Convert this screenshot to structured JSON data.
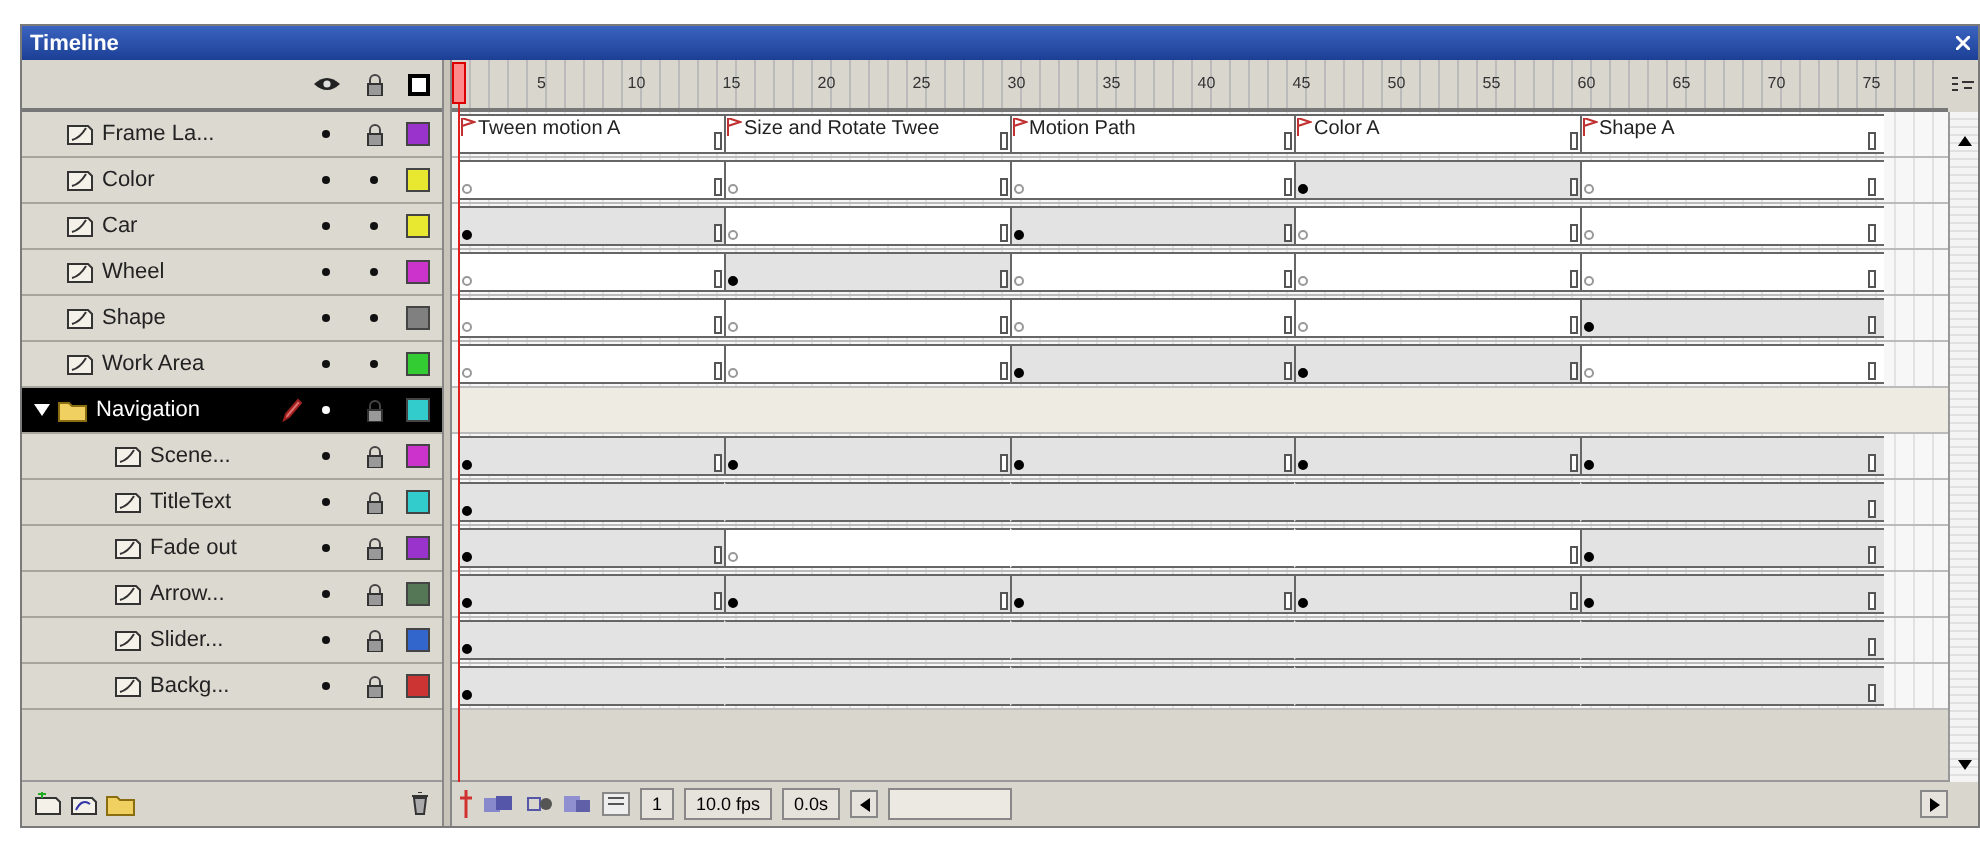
{
  "window": {
    "title": "Timeline"
  },
  "ruler": {
    "ticks": [
      "5",
      "10",
      "15",
      "20",
      "25",
      "30",
      "35",
      "40",
      "45",
      "50",
      "55",
      "60",
      "65",
      "70",
      "75"
    ]
  },
  "layers": [
    {
      "kind": "labels",
      "name": "Frame La...",
      "selected": false,
      "locked": true,
      "color": "#9933cc",
      "frames": [
        {
          "label": "Tween motion A"
        },
        {
          "label": "Size and Rotate Twee"
        },
        {
          "label": "Motion Path"
        },
        {
          "label": "Color A"
        },
        {
          "label": "Shape A"
        }
      ]
    },
    {
      "kind": "layer",
      "name": "Color",
      "selected": false,
      "locked": false,
      "color": "#e8e830",
      "frames": [
        {
          "keyframe": true,
          "content": false
        },
        {
          "keyframe": true,
          "content": false
        },
        {
          "keyframe": true,
          "content": false
        },
        {
          "keyframe": true,
          "content": true
        },
        {
          "keyframe": true,
          "content": false
        }
      ]
    },
    {
      "kind": "layer",
      "name": "Car",
      "selected": false,
      "locked": false,
      "color": "#e8e830",
      "frames": [
        {
          "keyframe": true,
          "content": true
        },
        {
          "keyframe": true,
          "content": false
        },
        {
          "keyframe": true,
          "content": true
        },
        {
          "keyframe": true,
          "content": false
        },
        {
          "keyframe": true,
          "content": false
        }
      ]
    },
    {
      "kind": "layer",
      "name": "Wheel",
      "selected": false,
      "locked": false,
      "color": "#cc33cc",
      "frames": [
        {
          "keyframe": true,
          "content": false
        },
        {
          "keyframe": true,
          "content": true
        },
        {
          "keyframe": true,
          "content": false
        },
        {
          "keyframe": true,
          "content": false
        },
        {
          "keyframe": true,
          "content": false
        }
      ]
    },
    {
      "kind": "layer",
      "name": "Shape",
      "selected": false,
      "locked": false,
      "color": "#808080",
      "frames": [
        {
          "keyframe": true,
          "content": false
        },
        {
          "keyframe": true,
          "content": false
        },
        {
          "keyframe": true,
          "content": false
        },
        {
          "keyframe": true,
          "content": false
        },
        {
          "keyframe": true,
          "content": true
        }
      ]
    },
    {
      "kind": "layer",
      "name": "Work Area",
      "selected": false,
      "locked": false,
      "color": "#33cc33",
      "frames": [
        {
          "keyframe": true,
          "content": false
        },
        {
          "keyframe": true,
          "content": false
        },
        {
          "keyframe": true,
          "content": true
        },
        {
          "keyframe": true,
          "content": true
        },
        {
          "keyframe": true,
          "content": false
        }
      ]
    },
    {
      "kind": "folder",
      "name": "Navigation",
      "selected": true,
      "expanded": true,
      "locked": true,
      "color": "#33cccc",
      "children": [
        {
          "kind": "layer",
          "name": "Scene...",
          "selected": false,
          "locked": true,
          "color": "#cc33cc",
          "frames": [
            {
              "keyframe": true,
              "content": true
            },
            {
              "keyframe": true,
              "content": true
            },
            {
              "keyframe": true,
              "content": true
            },
            {
              "keyframe": true,
              "content": true
            },
            {
              "keyframe": true,
              "content": true
            }
          ]
        },
        {
          "kind": "layer",
          "name": "TitleText",
          "selected": false,
          "locked": true,
          "color": "#33cccc",
          "frames": [
            {
              "keyframe": true,
              "content": true
            },
            {
              "keyframe": false,
              "content": true
            },
            {
              "keyframe": false,
              "content": true
            },
            {
              "keyframe": false,
              "content": true
            },
            {
              "keyframe": false,
              "content": true
            }
          ]
        },
        {
          "kind": "layer",
          "name": "Fade out",
          "selected": false,
          "locked": true,
          "color": "#9933cc",
          "frames": [
            {
              "keyframe": true,
              "content": true
            },
            {
              "keyframe": true,
              "content": false
            },
            {
              "keyframe": false,
              "content": false
            },
            {
              "keyframe": false,
              "content": false
            },
            {
              "keyframe": true,
              "content": true
            }
          ]
        },
        {
          "kind": "layer",
          "name": "Arrow...",
          "selected": false,
          "locked": true,
          "color": "#557755",
          "frames": [
            {
              "keyframe": true,
              "content": true
            },
            {
              "keyframe": true,
              "content": true
            },
            {
              "keyframe": true,
              "content": true
            },
            {
              "keyframe": true,
              "content": true
            },
            {
              "keyframe": true,
              "content": true
            }
          ]
        },
        {
          "kind": "layer",
          "name": "Slider...",
          "selected": false,
          "locked": true,
          "color": "#3366cc",
          "frames": [
            {
              "keyframe": true,
              "content": true
            },
            {
              "keyframe": false,
              "content": true
            },
            {
              "keyframe": false,
              "content": true
            },
            {
              "keyframe": false,
              "content": true
            },
            {
              "keyframe": false,
              "content": true
            }
          ]
        },
        {
          "kind": "layer",
          "name": "Backg...",
          "selected": false,
          "locked": true,
          "color": "#cc3333",
          "frames": [
            {
              "keyframe": true,
              "content": true
            },
            {
              "keyframe": false,
              "content": true
            },
            {
              "keyframe": false,
              "content": true
            },
            {
              "keyframe": false,
              "content": true
            },
            {
              "keyframe": false,
              "content": true
            }
          ]
        }
      ]
    }
  ],
  "footer": {
    "current_frame": "1",
    "fps": "10.0 fps",
    "time": "0.0s"
  }
}
